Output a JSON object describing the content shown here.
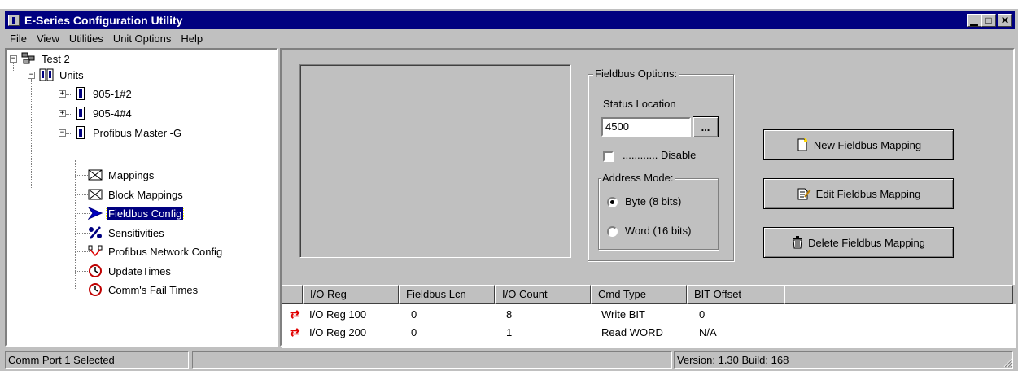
{
  "window": {
    "title": "E-Series Configuration Utility"
  },
  "title_buttons": {
    "minimize": "▁",
    "maximize": "□",
    "close": "✕"
  },
  "menu": [
    "File",
    "View",
    "Utilities",
    "Unit Options",
    "Help"
  ],
  "tree": {
    "root": "Test 2",
    "units": "Units",
    "unit_1": "905-1#2",
    "unit_2": "905-4#4",
    "profibus": "Profibus Master -G",
    "children": [
      "Mappings",
      "Block Mappings",
      "Fieldbus Config",
      "Sensitivities",
      "Profibus Network Config",
      "UpdateTimes",
      "Comm's Fail Times"
    ],
    "selected": "Fieldbus Config"
  },
  "fieldbus_options": {
    "group_title": "Fieldbus Options:",
    "status_location_label": "Status Location",
    "status_location_value": "4500",
    "browse_label": "...",
    "disable_label": "............ Disable",
    "disable_checked": false,
    "address_mode_title": "Address Mode:",
    "mode_byte": "Byte (8 bits)",
    "mode_word": "Word (16 bits)",
    "selected_mode": "byte"
  },
  "buttons": {
    "new_mapping": "New Fieldbus Mapping",
    "edit_mapping": "Edit Fieldbus Mapping",
    "delete_mapping": "Delete Fieldbus Mapping"
  },
  "grid": {
    "headers": [
      "I/O Reg",
      "Fieldbus Lcn",
      "I/O Count",
      "Cmd Type",
      "BIT Offset"
    ],
    "rows": [
      [
        "I/O Reg 100",
        "0",
        "8",
        "Write BIT",
        "0"
      ],
      [
        "I/O Reg 200",
        "0",
        "1",
        "Read WORD",
        "N/A"
      ]
    ]
  },
  "status": {
    "left": "Comm Port 1 Selected",
    "middle": "",
    "right": "Version: 1.30 Build: 168"
  },
  "colors": {
    "titlebar": "#000080",
    "face": "#c0c0c0",
    "selection": "#000080",
    "swap_icon": "#e00000"
  }
}
